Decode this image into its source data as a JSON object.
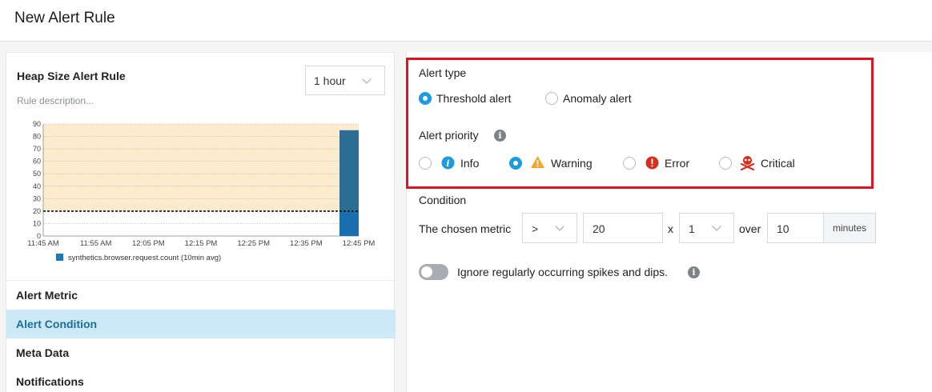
{
  "header": {
    "title": "New Alert Rule"
  },
  "rule": {
    "title": "Heap Size Alert Rule",
    "description_placeholder": "Rule description..."
  },
  "time_range": {
    "value": "1 hour"
  },
  "chart_data": {
    "type": "bar",
    "x": [
      "11:45 AM",
      "11:55 AM",
      "12:05 PM",
      "12:15 PM",
      "12:25 PM",
      "12:35 PM",
      "12:45 PM"
    ],
    "series": [
      {
        "name": "synthetics.browser.request.count (10min avg)",
        "values": [
          0,
          0,
          0,
          0,
          0,
          0,
          85
        ]
      }
    ],
    "y_ticks": [
      0,
      10,
      20,
      30,
      40,
      50,
      60,
      70,
      80,
      90
    ],
    "ylim": [
      0,
      90
    ],
    "threshold": 20,
    "grid": true,
    "legend": "bottom",
    "colors": {
      "bar": "#1f77b4",
      "bar_below_threshold": "#1a6faf",
      "warning_area": "#fdebcd",
      "threshold_line": "#111111"
    }
  },
  "nav": {
    "items": [
      "Alert Metric",
      "Alert Condition",
      "Meta Data",
      "Notifications"
    ],
    "active": "Alert Condition"
  },
  "alert_type": {
    "label": "Alert type",
    "options": [
      "Threshold alert",
      "Anomaly alert"
    ],
    "selected": "Threshold alert"
  },
  "alert_priority": {
    "label": "Alert priority",
    "options": [
      {
        "label": "Info",
        "icon": "info-icon"
      },
      {
        "label": "Warning",
        "icon": "warning-icon"
      },
      {
        "label": "Error",
        "icon": "error-icon"
      },
      {
        "label": "Critical",
        "icon": "skull-crossbones-icon"
      }
    ],
    "selected": "Warning"
  },
  "condition": {
    "label": "Condition",
    "metric_text": "The chosen metric",
    "operator": ">",
    "value": "20",
    "x_text": "x",
    "count": "1",
    "over_text": "over",
    "duration": "10",
    "unit": "minutes"
  },
  "ignore_spikes": {
    "label": "Ignore regularly occurring spikes and dips.",
    "enabled": false
  },
  "colors": {
    "accent": "#1c9be0",
    "highlight_border": "#e0141e",
    "nav_active_bg": "#cde9f8"
  }
}
